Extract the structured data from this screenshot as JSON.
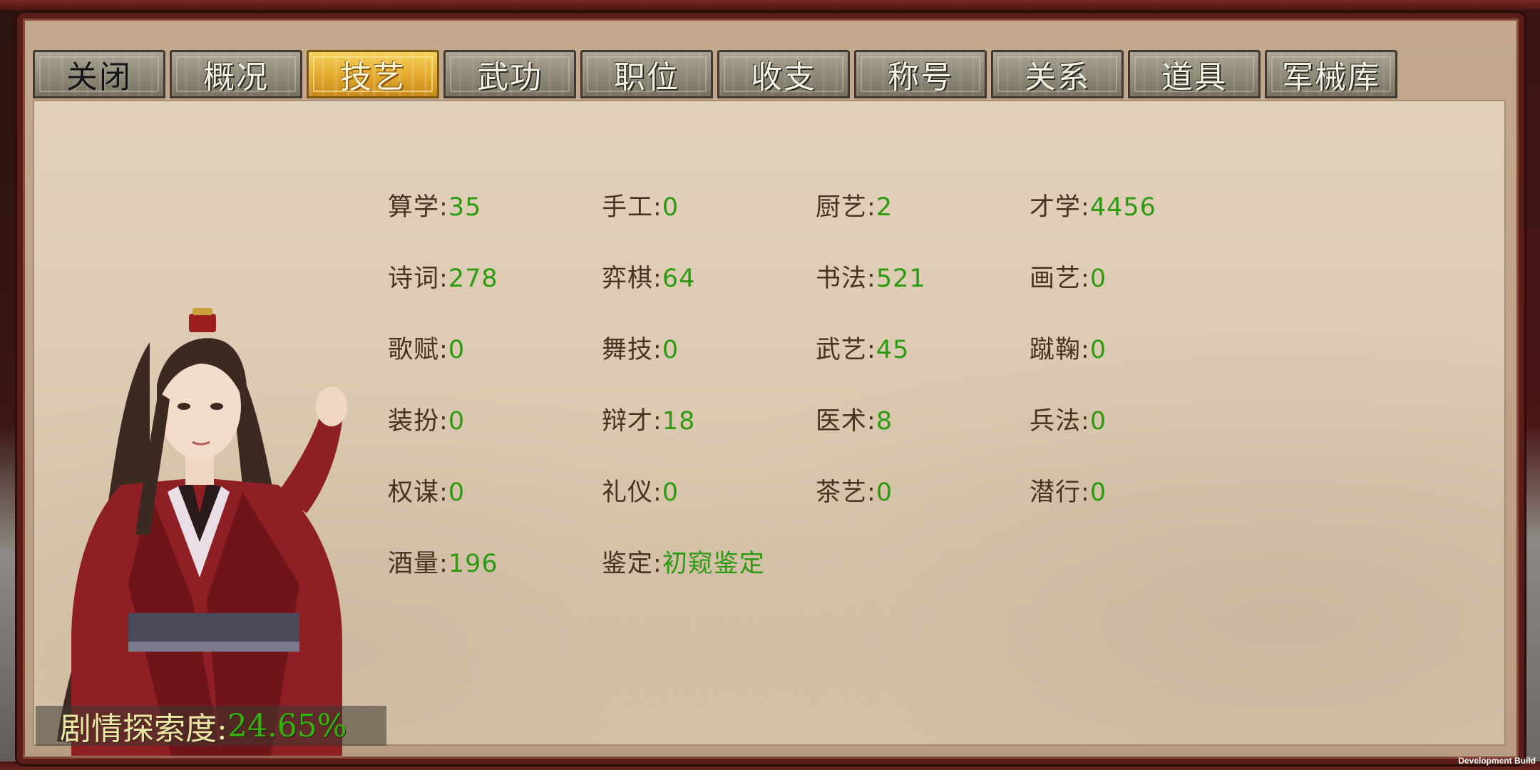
{
  "tabs": [
    {
      "label": "关闭",
      "state": "close"
    },
    {
      "label": "概况",
      "state": "normal"
    },
    {
      "label": "技艺",
      "state": "active"
    },
    {
      "label": "武功",
      "state": "normal"
    },
    {
      "label": "职位",
      "state": "normal"
    },
    {
      "label": "收支",
      "state": "normal"
    },
    {
      "label": "称号",
      "state": "normal"
    },
    {
      "label": "关系",
      "state": "normal"
    },
    {
      "label": "道具",
      "state": "normal"
    },
    {
      "label": "军械库",
      "state": "normal"
    }
  ],
  "skills": [
    {
      "label": "算学",
      "value": "35"
    },
    {
      "label": "手工",
      "value": "0"
    },
    {
      "label": "厨艺",
      "value": "2"
    },
    {
      "label": "才学",
      "value": "4456"
    },
    {
      "label": "诗词",
      "value": "278"
    },
    {
      "label": "弈棋",
      "value": "64"
    },
    {
      "label": "书法",
      "value": "521"
    },
    {
      "label": "画艺",
      "value": "0"
    },
    {
      "label": "歌赋",
      "value": "0"
    },
    {
      "label": "舞技",
      "value": "0"
    },
    {
      "label": "武艺",
      "value": "45"
    },
    {
      "label": "蹴鞠",
      "value": "0"
    },
    {
      "label": "装扮",
      "value": "0"
    },
    {
      "label": "辩才",
      "value": "18"
    },
    {
      "label": "医术",
      "value": "8"
    },
    {
      "label": "兵法",
      "value": "0"
    },
    {
      "label": "权谋",
      "value": "0"
    },
    {
      "label": "礼仪",
      "value": "0"
    },
    {
      "label": "茶艺",
      "value": "0"
    },
    {
      "label": "潜行",
      "value": "0"
    },
    {
      "label": "酒量",
      "value": "196"
    },
    {
      "label": "鉴定",
      "value": "初窥鉴定"
    }
  ],
  "separator": ":",
  "story_progress": {
    "label": "剧情探索度:",
    "value": "24.65%"
  },
  "dev_build": "Development Build",
  "colors": {
    "label_text": "#4a3222",
    "value_green": "#2e9a12",
    "active_tab": "#e2a92c",
    "frame_red": "#5b1d1a"
  }
}
